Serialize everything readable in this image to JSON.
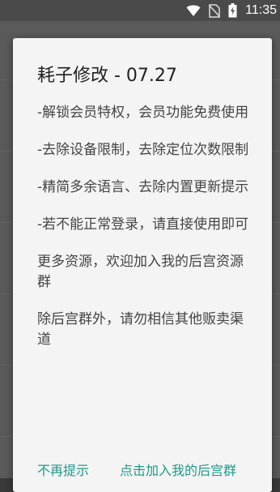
{
  "status_bar": {
    "time": "11:35",
    "icons": [
      "wifi-icon",
      "no-sim-icon",
      "battery-charging-icon"
    ]
  },
  "dialog": {
    "title": "耗子修改 - 07.27",
    "body": [
      "-解锁会员特权，会员功能免费使用",
      "-去除设备限制，去除定位次数限制",
      "-精简多余语言、去除内置更新提示",
      "-若不能正常登录，请直接使用即可",
      "更多资源，欢迎加入我的后宫资源群",
      "除后宫群外，请勿相信其他贩卖渠道"
    ],
    "actions": {
      "dismiss_label": "不再提示",
      "join_label": "点击加入我的后宫群"
    }
  },
  "colors": {
    "accent": "#1e9a8a",
    "dialog_bg": "#f4f4f4",
    "overlay": "#3a3a3a"
  }
}
